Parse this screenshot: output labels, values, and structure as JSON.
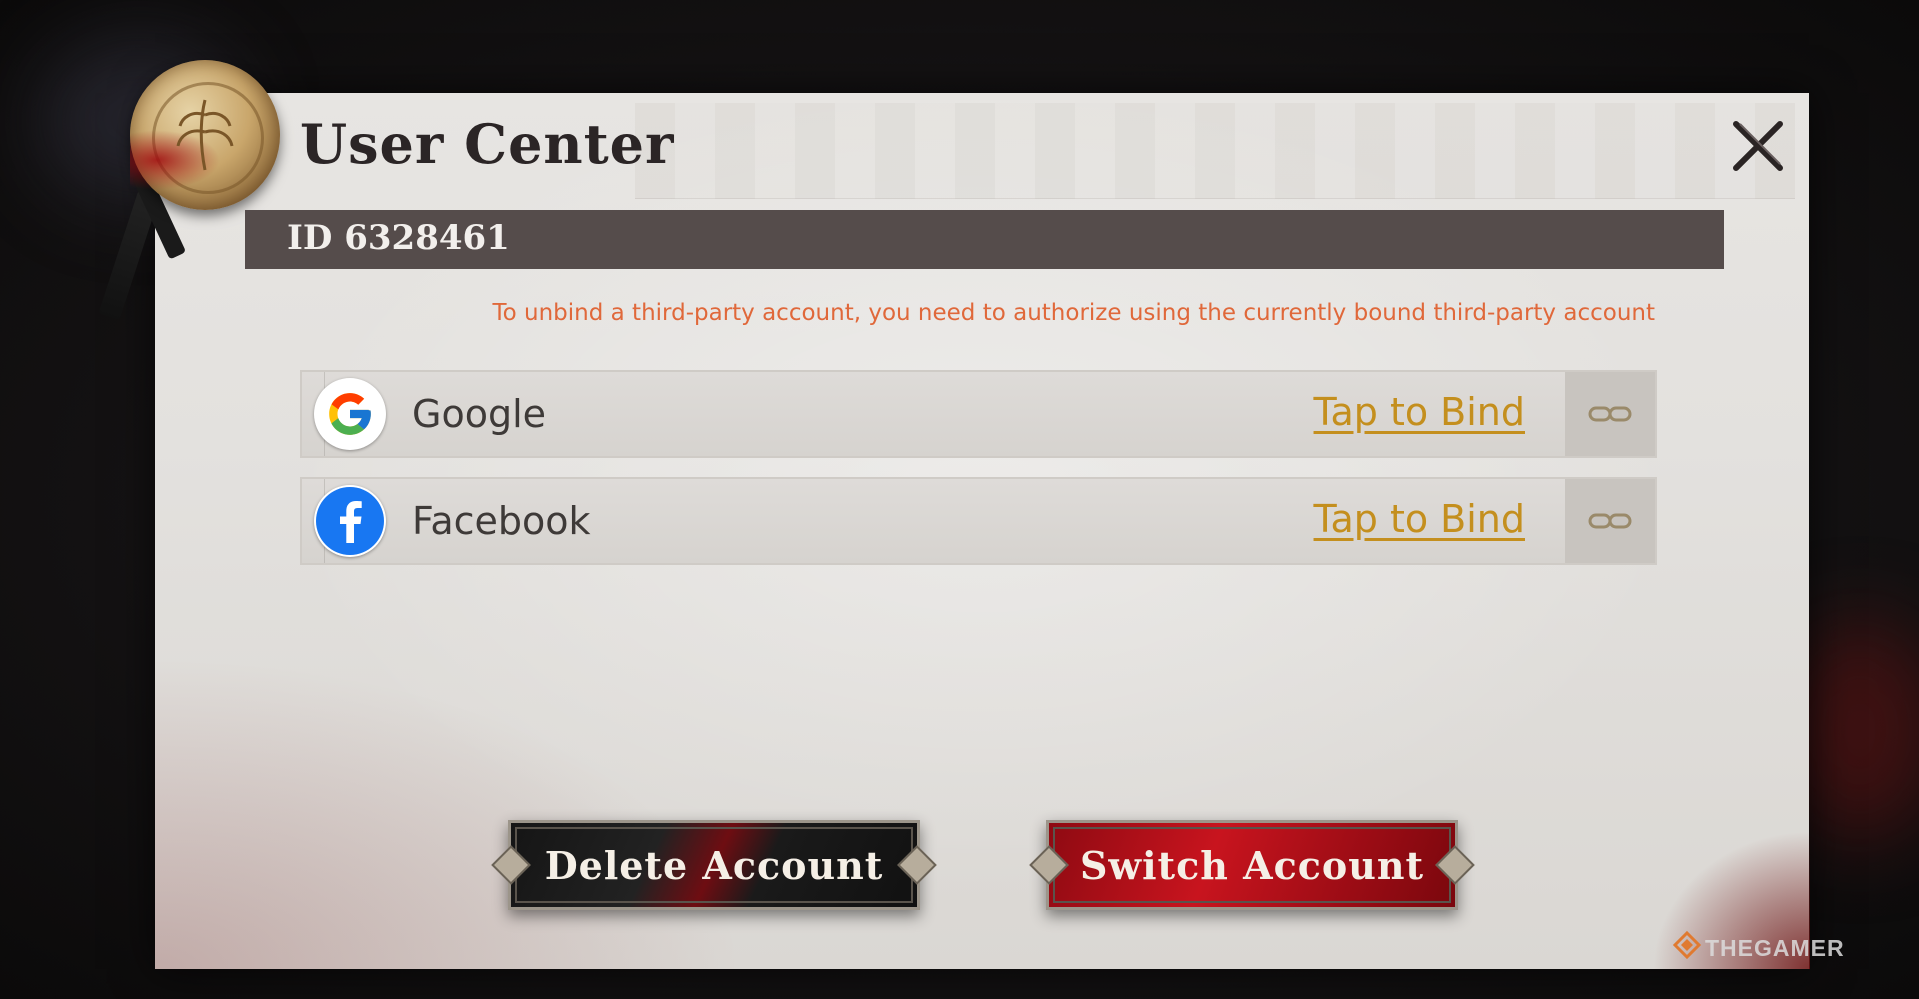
{
  "dialog": {
    "title": "User Center",
    "close_icon": "close-icon",
    "user_id_label": "ID 6328461",
    "notice": "To unbind a third-party account, you need to authorize using the currently bound third-party account"
  },
  "accounts": [
    {
      "provider": "Google",
      "icon": "google-icon",
      "action": "Tap to Bind",
      "link_icon": "link-icon"
    },
    {
      "provider": "Facebook",
      "icon": "facebook-icon",
      "action": "Tap to Bind",
      "link_icon": "link-icon"
    }
  ],
  "buttons": {
    "delete_label": "Delete Account",
    "switch_label": "Switch Account"
  },
  "watermark": "THEGAMER",
  "colors": {
    "notice": "#e0683a",
    "bind_link": "#c48f1e",
    "id_bar": "#554c4b",
    "switch_button": "#c8141e",
    "delete_button": "#151515"
  }
}
